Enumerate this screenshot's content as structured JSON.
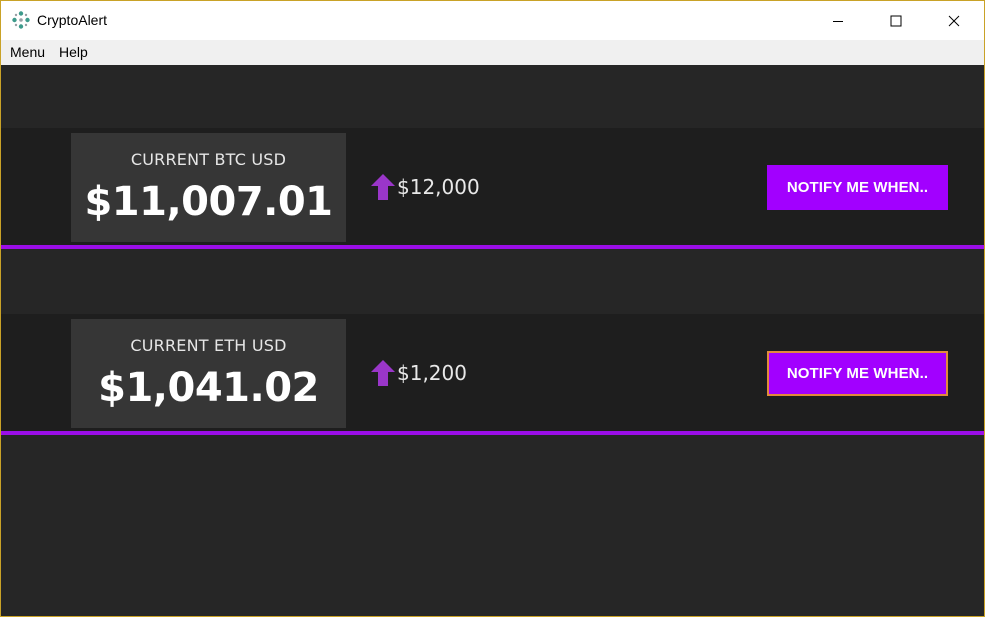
{
  "window": {
    "title": "CryptoAlert",
    "icon": "app-dots-icon"
  },
  "menu": {
    "items": [
      {
        "label": "Menu"
      },
      {
        "label": "Help"
      }
    ]
  },
  "colors": {
    "accent": "#a200ff",
    "divider": "#9b0ee8",
    "arrow": "#9a36c9",
    "background": "#262626",
    "row": "#1e1e1e",
    "card": "#363636"
  },
  "coins": [
    {
      "label": "CURRENT BTC USD",
      "price": "$11,007.01",
      "direction_icon": "arrow-up-icon",
      "target": "$12,000",
      "button": "NOTIFY ME WHEN.."
    },
    {
      "label": "CURRENT ETH USD",
      "price": "$1,041.02",
      "direction_icon": "arrow-up-icon",
      "target": "$1,200",
      "button": "NOTIFY ME WHEN.."
    }
  ]
}
